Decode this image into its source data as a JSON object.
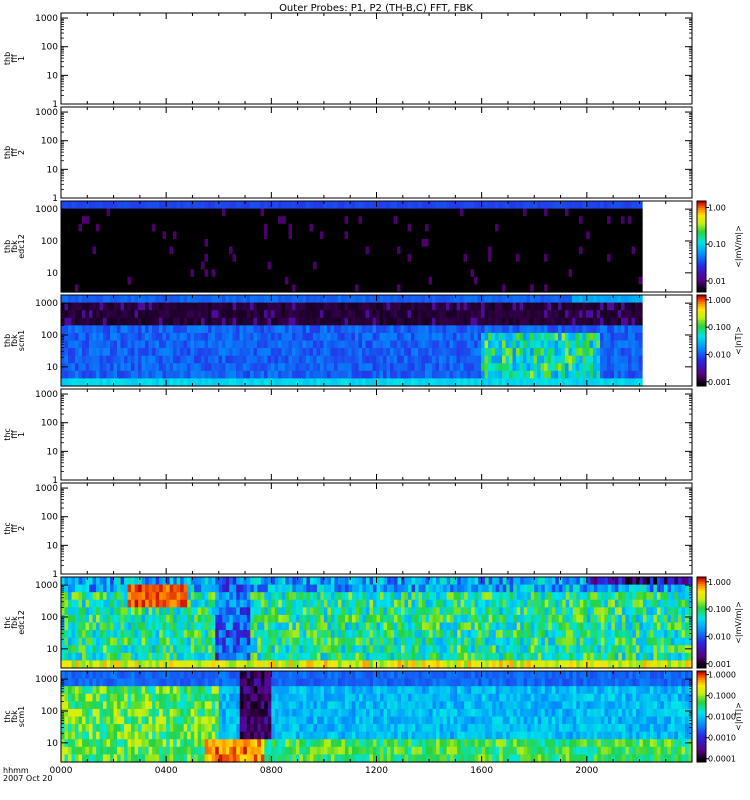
{
  "title": "Outer Probes: P1, P2 (TH-B,C) FFT, FBK",
  "chart_data": {
    "type": "heatmap",
    "x_ticks": [
      "0000",
      "0400",
      "0800",
      "1200",
      "1600",
      "2000"
    ],
    "x_tick_hours": [
      0,
      4,
      8,
      12,
      16,
      20
    ],
    "x_range_hours": [
      0,
      24
    ],
    "x_label_line1": "hhmm",
    "x_label_line2": "2007 Oct 20",
    "y_scale": "log",
    "panels": [
      {
        "label": [
          "thb",
          "fff",
          "1"
        ],
        "y_ticks": [
          "1000",
          "100",
          "10",
          "1"
        ],
        "y_ticks_values": [
          1000,
          100,
          10,
          1
        ],
        "y_range": [
          1,
          1500
        ],
        "empty": true
      },
      {
        "label": [
          "thb",
          "fff",
          "2"
        ],
        "y_ticks": [
          "1000",
          "100",
          "10",
          "1"
        ],
        "y_ticks_values": [
          1000,
          100,
          10,
          1
        ],
        "y_range": [
          1,
          1500
        ],
        "empty": true
      },
      {
        "label": [
          "thb",
          "fbk",
          "edc12"
        ],
        "y_ticks": [
          "1000",
          "100",
          "10"
        ],
        "y_ticks_values": [
          1000,
          100,
          10
        ],
        "y_range": [
          2.5,
          1800
        ],
        "empty": false,
        "data_end_hours": 22.1,
        "pattern": "thb_edc",
        "colorbar": {
          "ticks": [
            "1.00",
            "0.10",
            "0.01"
          ],
          "tick_values": [
            1.0,
            0.1,
            0.01
          ],
          "range": [
            0.005,
            1.5
          ],
          "unit": "<|mV/m|>"
        }
      },
      {
        "label": [
          "thb",
          "fbk",
          "scm1"
        ],
        "y_ticks": [
          "1000",
          "100",
          "10"
        ],
        "y_ticks_values": [
          1000,
          100,
          10
        ],
        "y_range": [
          2.5,
          1800
        ],
        "empty": false,
        "data_end_hours": 22.1,
        "pattern": "thb_scm",
        "colorbar": {
          "ticks": [
            "1.000",
            "0.100",
            "0.010",
            "0.001"
          ],
          "tick_values": [
            1.0,
            0.1,
            0.01,
            0.001
          ],
          "range": [
            0.0007,
            1.5
          ],
          "unit": "<|nT|>"
        }
      },
      {
        "label": [
          "thc",
          "fff",
          "1"
        ],
        "y_ticks": [
          "1000",
          "100",
          "10",
          "1"
        ],
        "y_ticks_values": [
          1000,
          100,
          10,
          1
        ],
        "y_range": [
          1,
          1500
        ],
        "empty": true
      },
      {
        "label": [
          "thc",
          "fff",
          "2"
        ],
        "y_ticks": [
          "1000",
          "100",
          "10",
          "1"
        ],
        "y_ticks_values": [
          1000,
          100,
          10,
          1
        ],
        "y_range": [
          1,
          1500
        ],
        "empty": true
      },
      {
        "label": [
          "thc",
          "fbk",
          "edc12"
        ],
        "y_ticks": [
          "1000",
          "100",
          "10"
        ],
        "y_ticks_values": [
          1000,
          100,
          10
        ],
        "y_range": [
          2.5,
          1800
        ],
        "empty": false,
        "data_end_hours": 24,
        "pattern": "thc_edc",
        "colorbar": {
          "ticks": [
            "1.000",
            "0.100",
            "0.010",
            "0.001"
          ],
          "tick_values": [
            1.0,
            0.1,
            0.01,
            0.001
          ],
          "range": [
            0.0007,
            1.5
          ],
          "unit": "<|mV/m|>"
        }
      },
      {
        "label": [
          "thc",
          "fbk",
          "scm1"
        ],
        "y_ticks": [
          "1000",
          "100",
          "10"
        ],
        "y_ticks_values": [
          1000,
          100,
          10
        ],
        "y_range": [
          2.5,
          1800
        ],
        "empty": false,
        "data_end_hours": 24,
        "pattern": "thc_scm",
        "colorbar": {
          "ticks": [
            "1.0000",
            "0.1000",
            "0.0100",
            "0.0010",
            "0.0001"
          ],
          "tick_values": [
            1.0,
            0.1,
            0.01,
            0.001,
            0.0001
          ],
          "range": [
            7e-05,
            1.5
          ],
          "unit": "<|nT|>"
        }
      }
    ]
  }
}
